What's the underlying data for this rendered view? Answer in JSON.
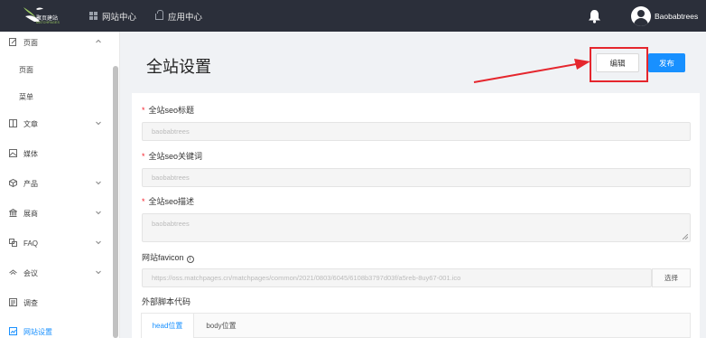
{
  "topbar": {
    "brand": "聚页建站",
    "brand_sub": "MATCHPAGES",
    "nav": [
      {
        "label": "网站中心",
        "icon": "grid-icon"
      },
      {
        "label": "应用中心",
        "icon": "bag-icon"
      }
    ],
    "username": "Baobabtrees"
  },
  "sidebar": {
    "items": [
      {
        "label": "页面",
        "icon": "edit-icon",
        "expanded": true
      },
      {
        "label": "页面",
        "sub": true
      },
      {
        "label": "菜单",
        "sub": true
      },
      {
        "label": "文章",
        "icon": "book-icon"
      },
      {
        "label": "媒体",
        "icon": "image-icon"
      },
      {
        "label": "产品",
        "icon": "cube-icon"
      },
      {
        "label": "展商",
        "icon": "bank-icon"
      },
      {
        "label": "FAQ",
        "icon": "faq-icon"
      },
      {
        "label": "会议",
        "icon": "meeting-icon"
      },
      {
        "label": "调查",
        "icon": "survey-icon"
      },
      {
        "label": "网站设置",
        "icon": "settings-icon",
        "active": true
      }
    ]
  },
  "main": {
    "title": "全站设置",
    "edit_label": "编辑",
    "publish_label": "发布",
    "fields": {
      "seo_title": {
        "label": "全站seo标题",
        "value": "baobabtrees"
      },
      "seo_keywords": {
        "label": "全站seo关键词",
        "value": "baobabtrees"
      },
      "seo_description": {
        "label": "全站seo描述",
        "value": "baobabtrees"
      },
      "favicon": {
        "label": "网站favicon",
        "value": "https://oss.matchpages.cn/matchpages/common/2021/0803/6045/6108b3797d03f/a5reb-8uy67-001.ico",
        "button": "选择"
      },
      "external_script": {
        "label": "外部脚本代码",
        "tabs": [
          "head位置",
          "body位置"
        ]
      }
    }
  },
  "colors": {
    "accent": "#1890ff",
    "topbar": "#2b2f3a",
    "annotation": "#e5262d"
  }
}
